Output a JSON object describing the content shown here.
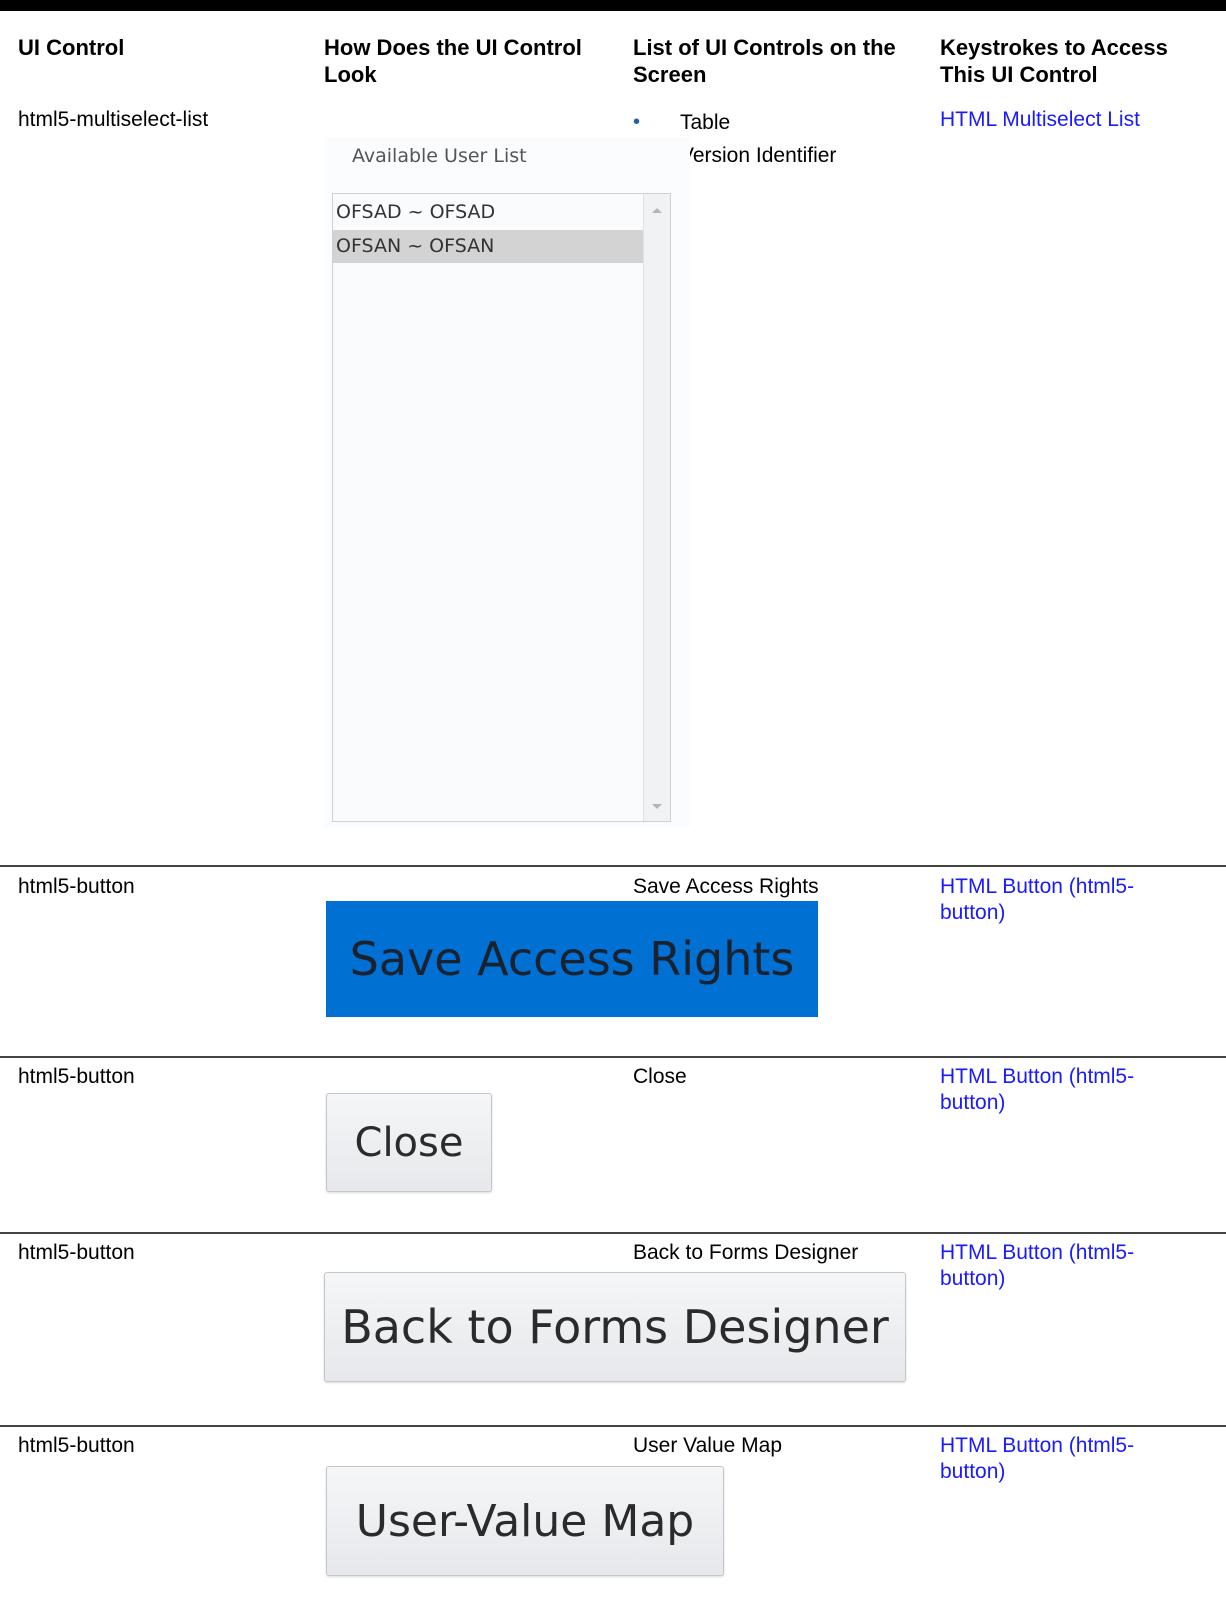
{
  "headers": {
    "col1": "UI Control",
    "col2": "How Does the UI Control Look",
    "col3": "List of UI Controls on the Screen",
    "col4": "Keystrokes to Access This UI Control"
  },
  "rows": [
    {
      "control": "html5-multiselect-list",
      "screen_controls": [
        "Table",
        "Version Identifier"
      ],
      "keystrokes": "HTML Multiselect List",
      "image": {
        "title": "Available User List",
        "items": [
          "OFSAD ~ OFSAD",
          "OFSAN ~ OFSAN"
        ],
        "selected_index": 1
      }
    },
    {
      "control": "html5-button",
      "screen_control": "Save Access Rights",
      "keystrokes": "HTML Button (html5-button)",
      "image_label": "Save Access Rights"
    },
    {
      "control": "html5-button",
      "screen_control": "Close",
      "keystrokes": "HTML Button (html5-button)",
      "image_label": "Close"
    },
    {
      "control": "html5-button",
      "screen_control": "Back to Forms Designer",
      "keystrokes": "HTML Button (html5-button)",
      "image_label": "Back to Forms Designer"
    },
    {
      "control": "html5-button",
      "screen_control": "User Value Map",
      "keystrokes": "HTML Button (html5-button)",
      "image_label": "User-Value Map"
    }
  ],
  "colors": {
    "link": "#1a1aff",
    "primary_button": "#0070d2",
    "bullet": "#1f5fb0"
  }
}
